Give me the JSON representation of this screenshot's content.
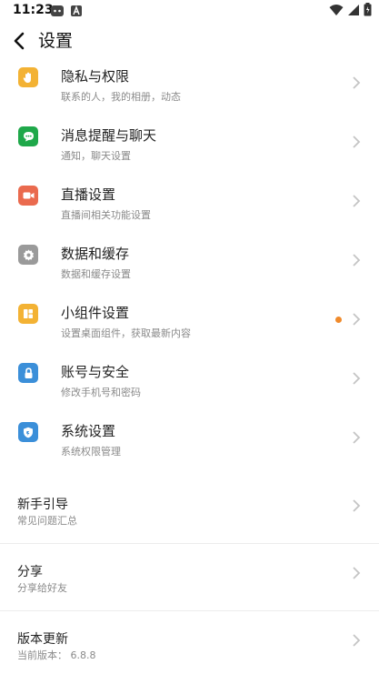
{
  "status_bar": {
    "time": "11:23"
  },
  "header": {
    "title": "设置"
  },
  "menu": [
    {
      "title": "隐私与权限",
      "subtitle": "联系的人，我的相册，动态",
      "icon": "hand-icon",
      "color": "#f3b234"
    },
    {
      "title": "消息提醒与聊天",
      "subtitle": "通知，聊天设置",
      "icon": "chat-bubble-icon",
      "color": "#1fa84a"
    },
    {
      "title": "直播设置",
      "subtitle": "直播间相关功能设置",
      "icon": "video-camera-icon",
      "color": "#ea6a4e"
    },
    {
      "title": "数据和缓存",
      "subtitle": "数据和缓存设置",
      "icon": "gear-icon",
      "color": "#9a9a9a"
    },
    {
      "title": "小组件设置",
      "subtitle": "设置桌面组件，获取最新内容",
      "icon": "widget-icon",
      "color": "#f3b234"
    },
    {
      "title": "账号与安全",
      "subtitle": "修改手机号和密码",
      "icon": "lock-icon",
      "color": "#3b8fd9"
    },
    {
      "title": "系统设置",
      "subtitle": "系统权限管理",
      "icon": "shield-icon",
      "color": "#3b8fd9"
    }
  ],
  "simple": [
    {
      "title": "新手引导",
      "subtitle": "常见问题汇总"
    },
    {
      "title": "分享",
      "subtitle": "分享给好友"
    },
    {
      "title": "版本更新",
      "subtitle": "当前版本：  6.8.8"
    }
  ],
  "colors": {
    "accent_dot": "#f08a2b",
    "chevron": "#c4c4c4"
  }
}
